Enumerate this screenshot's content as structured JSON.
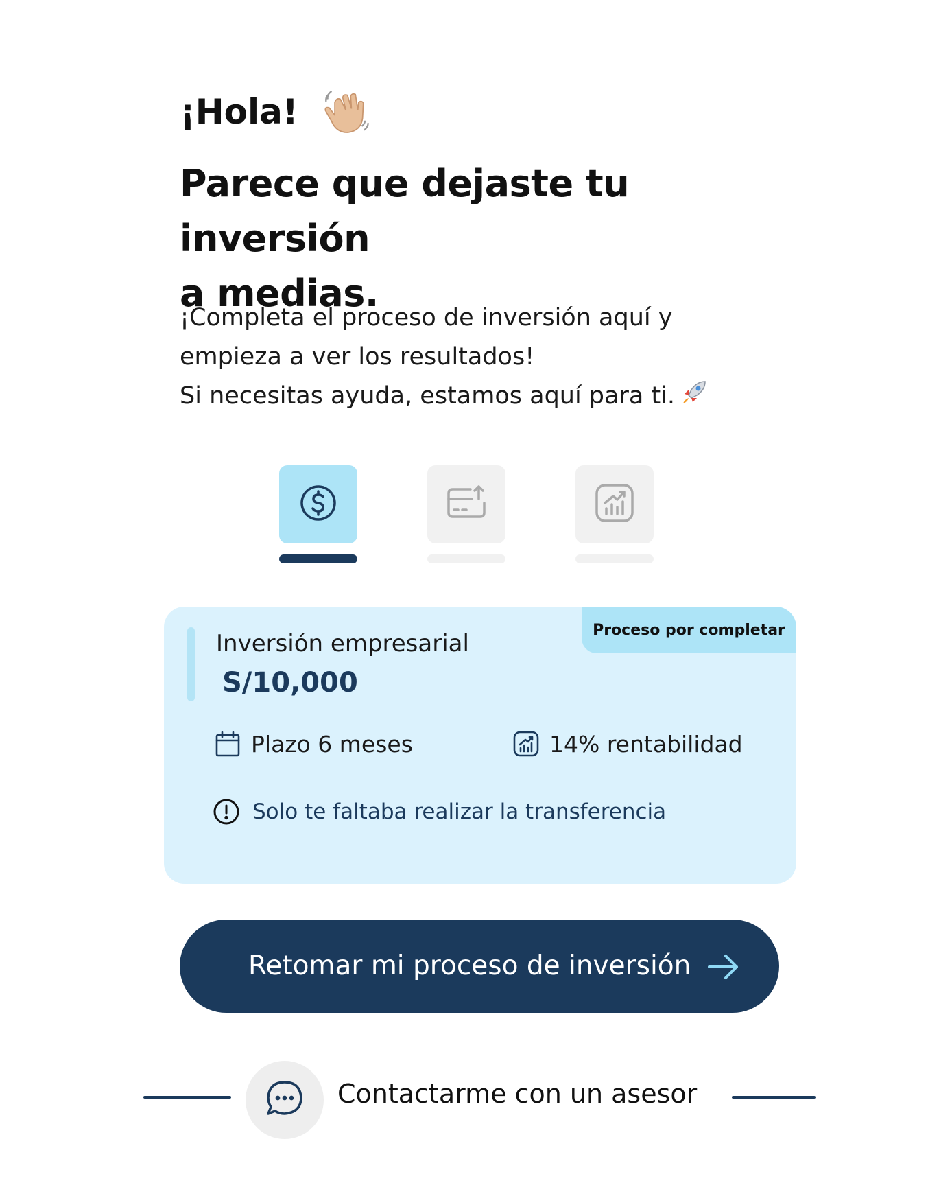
{
  "greeting": {
    "text": "¡Hola!",
    "emoji_icon": "waving-hand-icon"
  },
  "headline": {
    "line1": "Parece que dejaste tu inversión",
    "line2": "a medias."
  },
  "message": {
    "line1": "¡Completa el proceso de inversión aquí y",
    "line2": "empieza a ver los resultados!",
    "line3": "Si necesitas ayuda, estamos aquí para ti.",
    "line3_emoji_icon": "rocket-icon"
  },
  "steps": [
    {
      "icon": "dollar-circle-icon",
      "active": true
    },
    {
      "icon": "card-transfer-icon",
      "active": false
    },
    {
      "icon": "growth-chart-icon",
      "active": false
    }
  ],
  "investment_card": {
    "badge": "Proceso por completar",
    "title": "Inversión empresarial",
    "amount": "S/10,000",
    "term": "Plazo 6 meses",
    "term_icon": "calendar-icon",
    "return": "14% rentabilidad",
    "return_icon": "growth-chart-icon",
    "pending_note": "Solo te faltaba realizar la transferencia",
    "pending_icon": "alert-circle-icon"
  },
  "cta": {
    "label": "Retomar mi proceso de inversión",
    "icon": "arrow-right-icon"
  },
  "contact": {
    "label": "Contactarme con un asesor",
    "icon": "chat-bubble-icon"
  },
  "colors": {
    "primary": "#1b3a5c",
    "card_bg": "#dbf2fd",
    "badge_bg": "#ade4f7",
    "active_step_bg": "#ade4f7",
    "inactive_step_bg": "#f1f1f1",
    "arrow": "#8fd8f5"
  }
}
